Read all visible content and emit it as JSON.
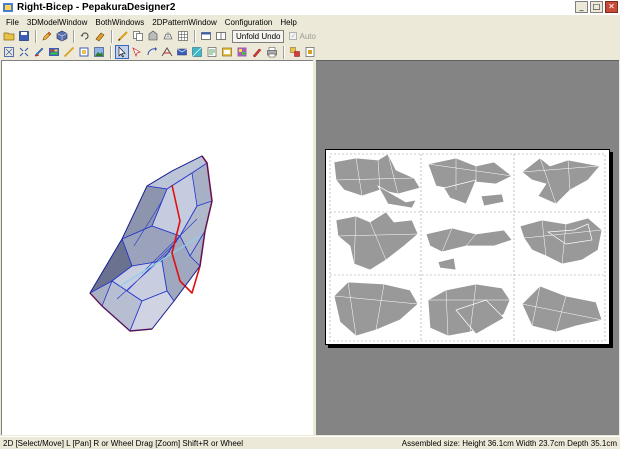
{
  "window": {
    "title": "Right-Bicep - PepakuraDesigner2"
  },
  "window_buttons": {
    "minimize": "_",
    "maximize": "□",
    "close": "✕"
  },
  "menu": [
    "File",
    "3DModelWindow",
    "BothWindows",
    "2DPatternWindow",
    "Configuration",
    "Help"
  ],
  "toolbar": {
    "unfold_undo_label": "Unfold Undo",
    "auto_label": "Auto",
    "auto_checked": true,
    "auto_enabled": false
  },
  "status": {
    "left": "2D [Select/Move] L [Pan] R or Wheel Drag [Zoom] Shift+R or Wheel",
    "right": "Assembled size: Height 36.1cm Width 23.7cm Depth 35.1cm"
  },
  "colors": {
    "pane_2d_bg": "#848484",
    "pane_3d_bg": "#ffffff",
    "part_fill": "#999999",
    "model_fill": "#a8b0c6",
    "model_edge_blue": "#2233cc",
    "model_edge_red": "#dd1111"
  }
}
